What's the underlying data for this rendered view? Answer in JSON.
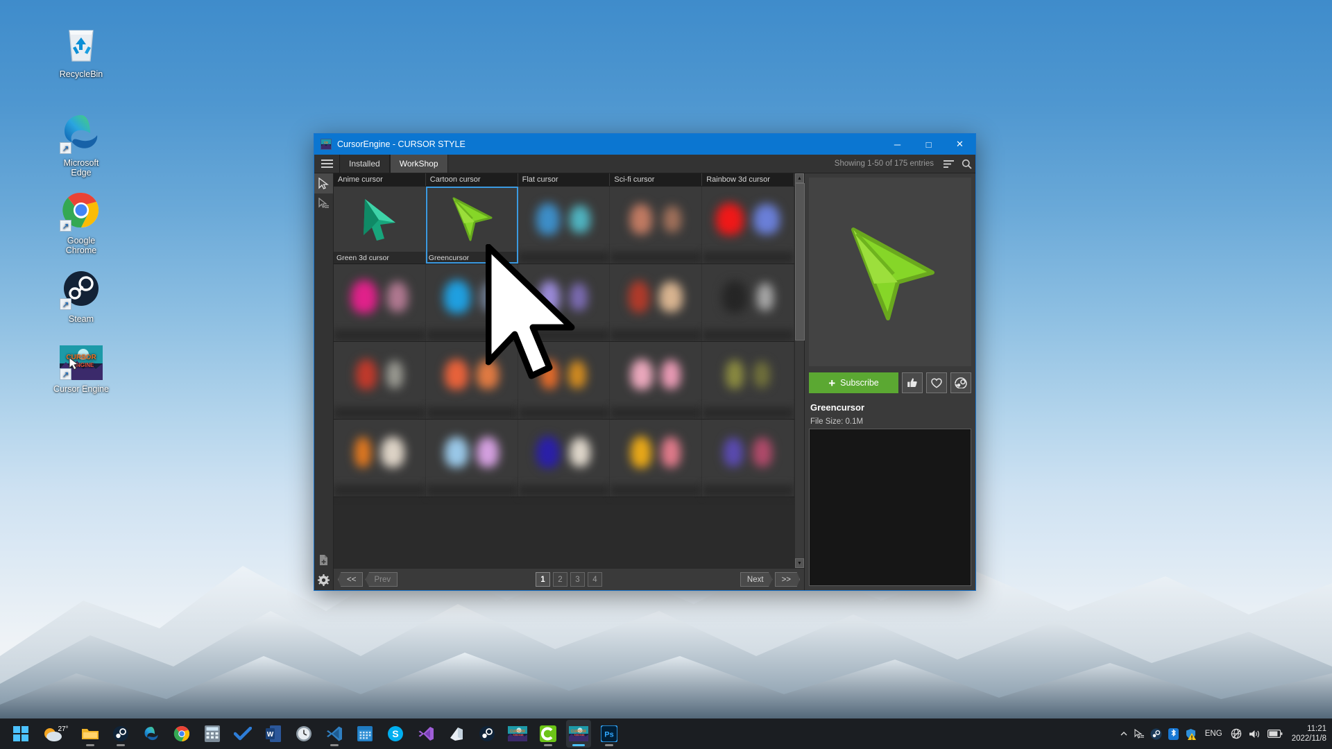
{
  "desktop": {
    "icons": [
      {
        "label": "RecycleBin",
        "icon": "recycle-bin-icon",
        "shortcut": false
      },
      {
        "label": "Microsoft\nEdge",
        "icon": "microsoft-edge-icon",
        "shortcut": true
      },
      {
        "label": "Google\nChrome",
        "icon": "google-chrome-icon",
        "shortcut": true
      },
      {
        "label": "Steam",
        "icon": "steam-icon",
        "shortcut": true
      },
      {
        "label": "Cursor Engine",
        "icon": "cursor-engine-icon",
        "shortcut": true
      }
    ]
  },
  "window": {
    "title": "CursorEngine - CURSOR STYLE",
    "icon": "cursor-engine-icon",
    "controls": {
      "minimize": "─",
      "maximize": "□",
      "close": "✕"
    },
    "accent_color": "#0b76d1"
  },
  "toolbar": {
    "menu_icon": "hamburger-icon",
    "tabs": [
      {
        "label": "Installed",
        "active": false
      },
      {
        "label": "WorkShop",
        "active": true
      }
    ],
    "entries_text": "Showing 1-50 of 175 entries",
    "sort_icon": "sort-icon",
    "search_icon": "search-icon"
  },
  "sidebar": {
    "items": [
      {
        "name": "cursor-tool",
        "icon": "cursor-arrow-icon",
        "active": true
      },
      {
        "name": "cursor-scheme-tool",
        "icon": "cursor-lines-icon",
        "active": false
      }
    ],
    "bottom_items": [
      {
        "name": "add-file",
        "icon": "file-add-icon"
      },
      {
        "name": "settings",
        "icon": "gear-icon"
      }
    ]
  },
  "grid": {
    "columns": [
      "Anime cursor",
      "Cartoon cursor",
      "Flat cursor",
      "Sci-fi cursor",
      "Rainbow 3d cursor"
    ],
    "rows": [
      {
        "items": [
          {
            "label": "Green 3d cursor",
            "blurred": false,
            "selected": false,
            "thumb": "green-3d-cursor-thumb",
            "color": "#16a07a"
          },
          {
            "label": "Greencursor",
            "blurred": false,
            "selected": true,
            "thumb": "greencursor-thumb",
            "color": "#7ed321"
          },
          {
            "label": "",
            "blurred": true,
            "selected": false,
            "thumb": "blurred-thumb",
            "color": "#3d6ea8"
          },
          {
            "label": "",
            "blurred": true,
            "selected": false,
            "thumb": "blurred-thumb",
            "color": "#a86a5a"
          },
          {
            "label": "",
            "blurred": true,
            "selected": false,
            "thumb": "blurred-thumb",
            "color": "#e02020"
          }
        ]
      },
      {
        "items": [
          {
            "label": "",
            "blurred": true,
            "selected": false,
            "thumb": "blurred-thumb",
            "color": "#e0218a"
          },
          {
            "label": "",
            "blurred": true,
            "selected": false,
            "thumb": "blurred-thumb",
            "color": "#1f9fe0"
          },
          {
            "label": "",
            "blurred": true,
            "selected": false,
            "thumb": "blurred-thumb",
            "color": "#8a7ad0"
          },
          {
            "label": "",
            "blurred": true,
            "selected": false,
            "thumb": "blurred-thumb",
            "color": "#b03a2a"
          },
          {
            "label": "",
            "blurred": true,
            "selected": false,
            "thumb": "blurred-thumb",
            "color": "#2a2a2a"
          }
        ]
      },
      {
        "items": [
          {
            "label": "",
            "blurred": true,
            "selected": false,
            "thumb": "blurred-thumb",
            "color": "#c0392b"
          },
          {
            "label": "",
            "blurred": true,
            "selected": false,
            "thumb": "blurred-thumb",
            "color": "#e8623a"
          },
          {
            "label": "",
            "blurred": true,
            "selected": false,
            "thumb": "blurred-thumb",
            "color": "#d08a20"
          },
          {
            "label": "",
            "blurred": true,
            "selected": false,
            "thumb": "blurred-thumb",
            "color": "#e8a0b8"
          },
          {
            "label": "",
            "blurred": true,
            "selected": false,
            "thumb": "blurred-thumb",
            "color": "#8a8a40"
          }
        ]
      },
      {
        "items": [
          {
            "label": "",
            "blurred": true,
            "selected": false,
            "thumb": "blurred-thumb",
            "color": "#e07820"
          },
          {
            "label": "",
            "blurred": true,
            "selected": false,
            "thumb": "blurred-thumb",
            "color": "#9ac8e8"
          },
          {
            "label": "",
            "blurred": true,
            "selected": false,
            "thumb": "blurred-thumb",
            "color": "#3a2ab0"
          },
          {
            "label": "",
            "blurred": true,
            "selected": false,
            "thumb": "blurred-thumb",
            "color": "#e8b020"
          },
          {
            "label": "",
            "blurred": true,
            "selected": false,
            "thumb": "blurred-thumb",
            "color": "#5a4ab0"
          }
        ]
      }
    ]
  },
  "pagination": {
    "first_label": "<<",
    "prev_label": "Prev",
    "pages": [
      "1",
      "2",
      "3",
      "4"
    ],
    "active_page": "1",
    "next_label": "Next",
    "last_label": ">>"
  },
  "detail": {
    "preview_icon": "greencursor-preview",
    "subscribe_label": "Subscribe",
    "subscribe_plus": "+",
    "subscribe_color": "#5ba832",
    "like_icon": "thumbs-up-icon",
    "favorite_icon": "heart-icon",
    "steam_icon": "steam-icon",
    "title": "Greencursor",
    "file_size": "File Size: 0.1M"
  },
  "taskbar": {
    "items": [
      {
        "name": "start-button",
        "icon": "windows-logo-icon",
        "running": false,
        "active": false
      },
      {
        "name": "weather-widget",
        "icon": "weather-icon",
        "label": "27°",
        "running": false,
        "active": false
      },
      {
        "name": "file-explorer",
        "icon": "folder-icon",
        "running": true,
        "active": false
      },
      {
        "name": "steam",
        "icon": "steam-icon",
        "running": true,
        "active": false
      },
      {
        "name": "microsoft-edge",
        "icon": "microsoft-edge-icon",
        "running": false,
        "active": false
      },
      {
        "name": "google-chrome",
        "icon": "google-chrome-icon",
        "running": false,
        "active": false
      },
      {
        "name": "calculator",
        "icon": "calculator-icon",
        "running": false,
        "active": false
      },
      {
        "name": "todo",
        "icon": "checkmark-icon",
        "running": false,
        "active": false
      },
      {
        "name": "microsoft-word",
        "icon": "word-icon",
        "running": false,
        "active": false
      },
      {
        "name": "clock-app",
        "icon": "clock-icon",
        "running": false,
        "active": false
      },
      {
        "name": "vs-code",
        "icon": "vscode-icon",
        "running": true,
        "active": false
      },
      {
        "name": "calendar",
        "icon": "calendar-icon",
        "running": false,
        "active": false
      },
      {
        "name": "skype",
        "icon": "skype-icon",
        "running": false,
        "active": false
      },
      {
        "name": "visual-studio",
        "icon": "visual-studio-icon",
        "running": false,
        "active": false
      },
      {
        "name": "onenote",
        "icon": "onenote-icon",
        "running": false,
        "active": false
      },
      {
        "name": "steam-2",
        "icon": "steam-icon",
        "running": false,
        "active": false
      },
      {
        "name": "cursor-engine-store",
        "icon": "cursor-engine-icon",
        "running": false,
        "active": false
      },
      {
        "name": "c-app",
        "icon": "c-green-icon",
        "running": true,
        "active": false
      },
      {
        "name": "cursor-engine",
        "icon": "cursor-engine-icon",
        "running": true,
        "active": true
      },
      {
        "name": "photoshop",
        "icon": "photoshop-icon",
        "running": true,
        "active": false
      }
    ],
    "tray": [
      {
        "name": "show-hidden-icons",
        "icon": "chevron-up-icon"
      },
      {
        "name": "cursor-tray",
        "icon": "cursor-small-icon"
      },
      {
        "name": "steam-tray",
        "icon": "steam-icon"
      },
      {
        "name": "bluetooth",
        "icon": "bluetooth-icon"
      },
      {
        "name": "windows-security",
        "icon": "shield-warning-icon"
      }
    ],
    "language": "ENG",
    "status": [
      {
        "name": "network",
        "icon": "network-globe-icon"
      },
      {
        "name": "volume",
        "icon": "speaker-icon"
      },
      {
        "name": "battery",
        "icon": "battery-icon"
      }
    ],
    "clock_time": "11:21",
    "clock_date": "2022/11/8"
  }
}
